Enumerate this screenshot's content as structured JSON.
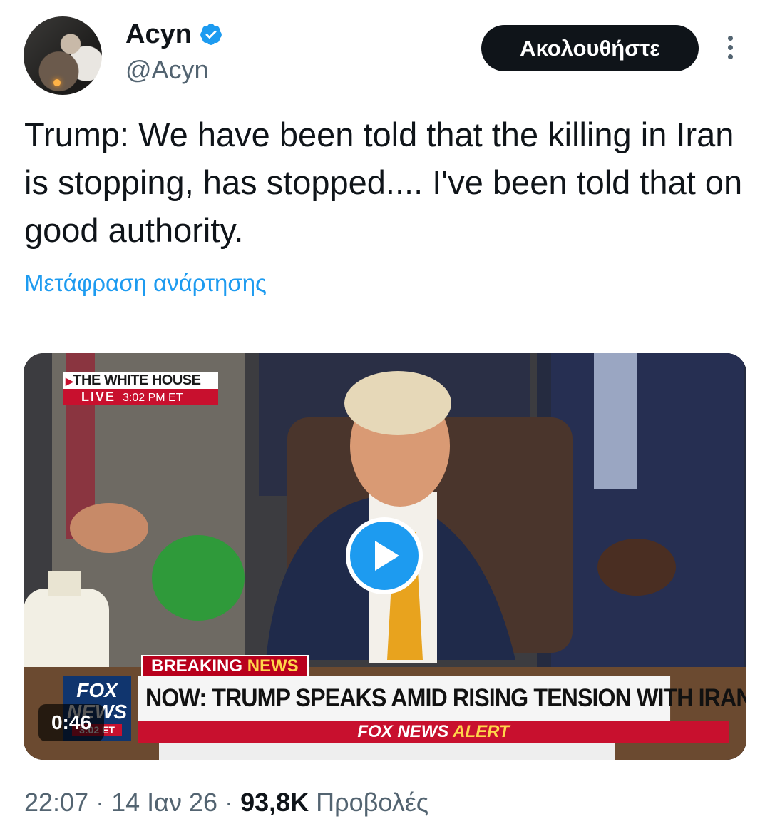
{
  "user": {
    "display_name": "Acyn",
    "handle": "@Acyn",
    "verified_icon": "verified-badge-icon"
  },
  "header": {
    "follow_label": "Ακολουθήστε",
    "more_icon": "more-vertical-icon"
  },
  "tweet": {
    "text": "Trump: We have been told that the killing in Iran is stopping, has stopped.... I've been told that on good authority.",
    "translate_label": "Μετάφραση ανάρτησης"
  },
  "video": {
    "duration": "0:46",
    "play_icon": "play-icon",
    "overlay": {
      "location": "THE WHITE HOUSE",
      "live": "LIVE",
      "time": "3:02 PM ET",
      "breaking_1": "BREAKING",
      "breaking_2": "NEWS",
      "headline": "NOW: TRUMP SPEAKS AMID RISING TENSION WITH IRAN",
      "logo_top": "FOX",
      "logo_bottom": "NEWS",
      "logo_et": "3:02 ET",
      "alert_1": "FOX NEWS",
      "alert_2": "ALERT"
    }
  },
  "meta": {
    "time": "22:07",
    "date": "14 Ιαν 26",
    "views_count": "93,8K",
    "views_label": "Προβολές",
    "separator": "·"
  },
  "colors": {
    "accent": "#1d9bf0",
    "text_primary": "#0f1419",
    "text_secondary": "#536471",
    "fox_red": "#c8102e"
  }
}
